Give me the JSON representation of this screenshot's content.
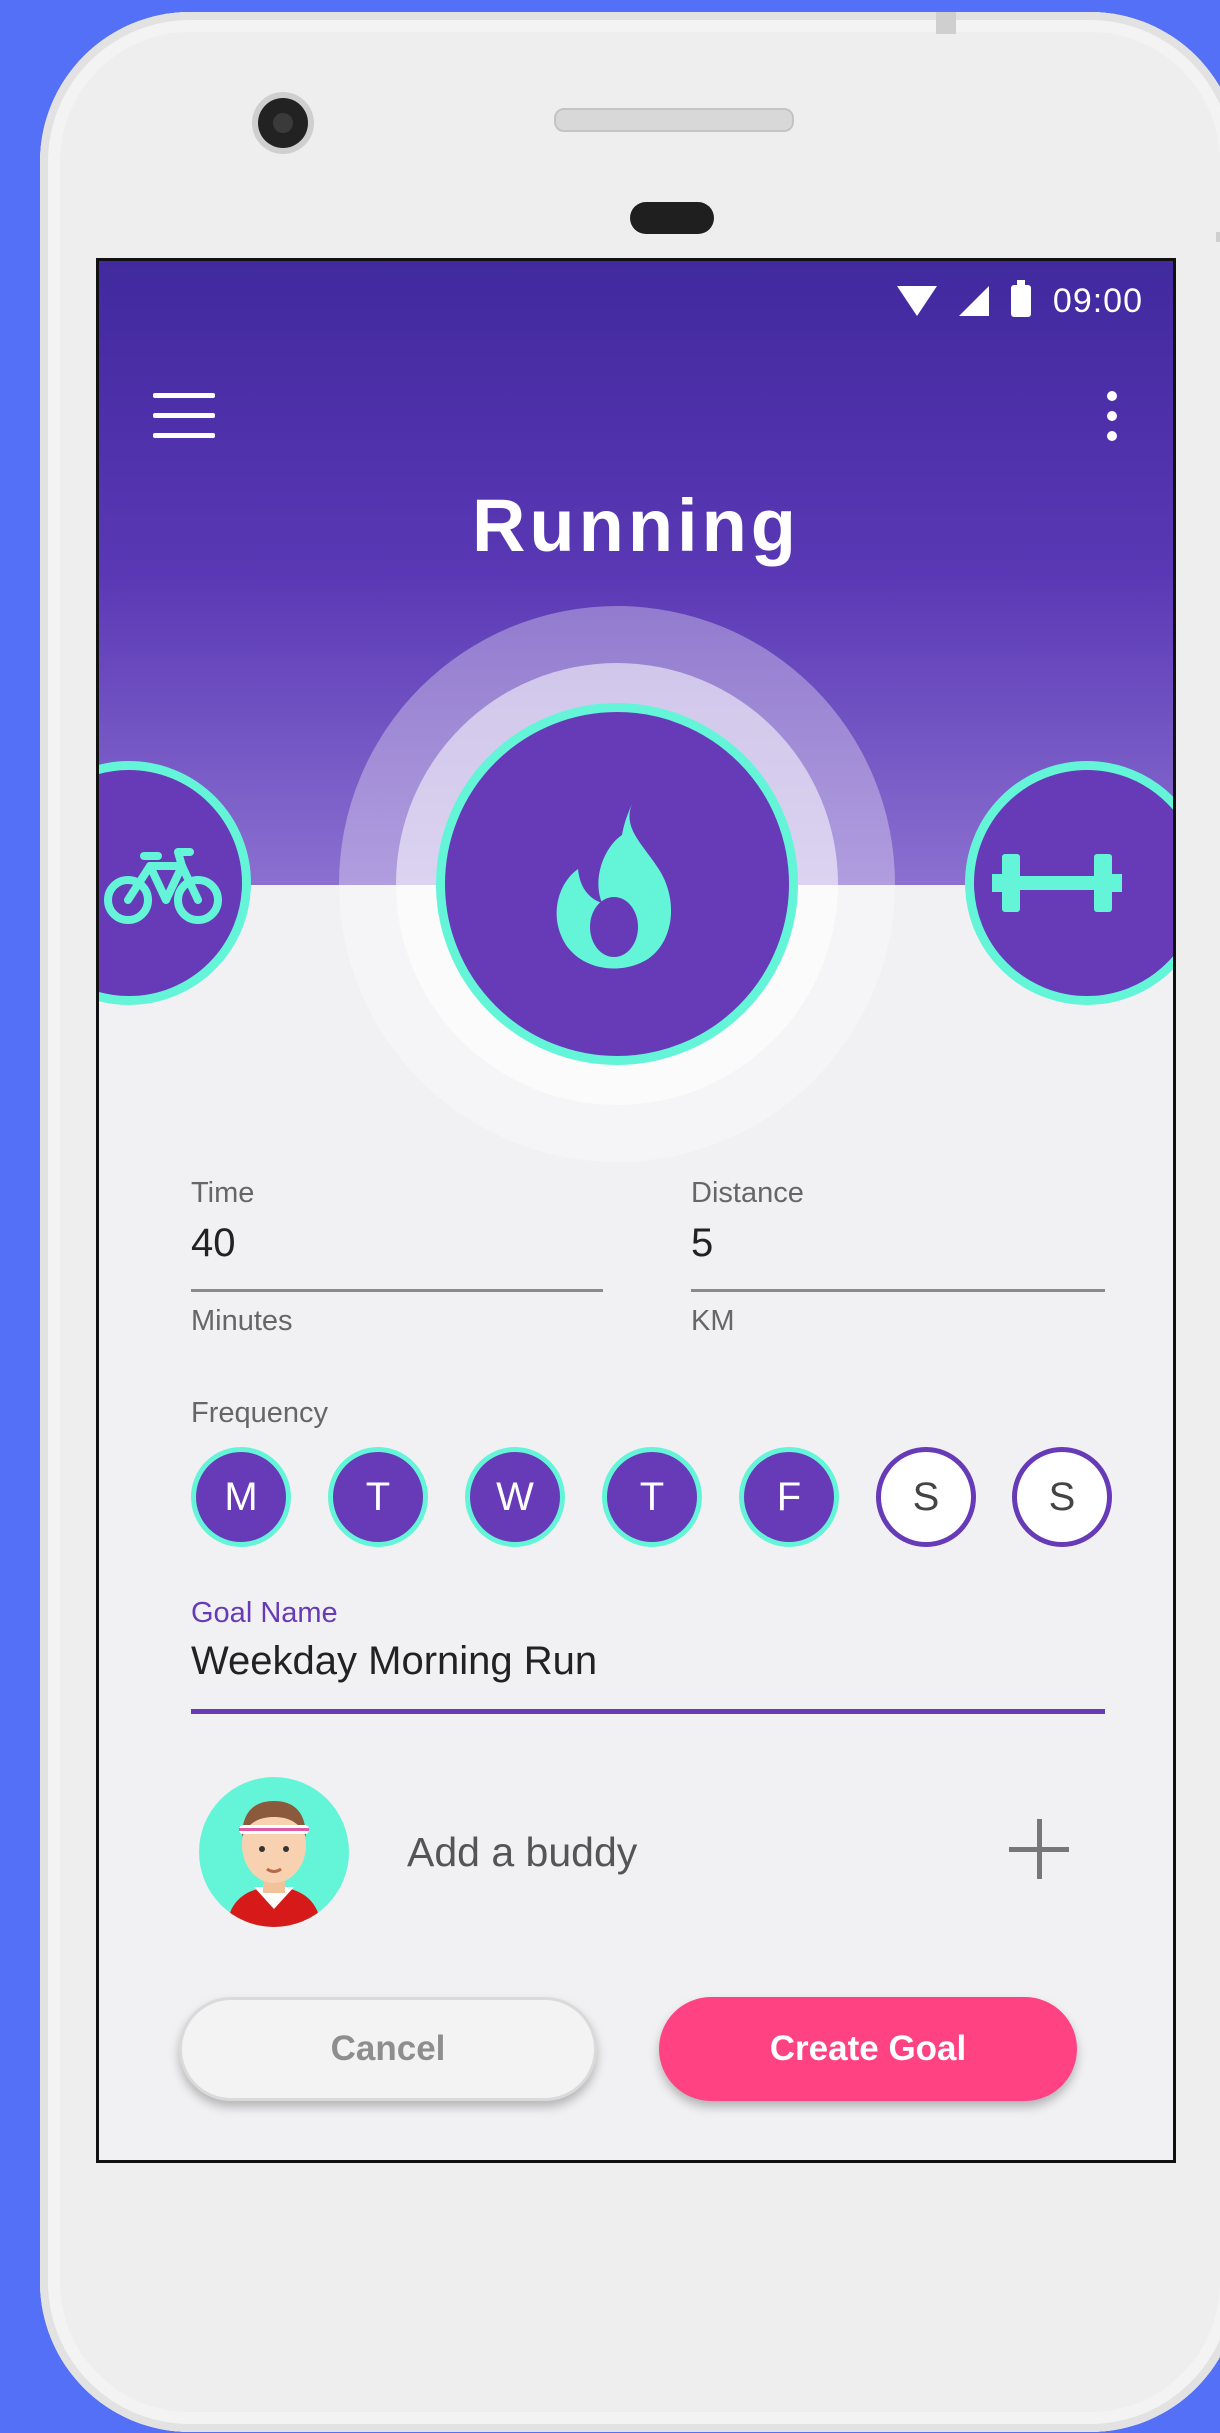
{
  "colors": {
    "background": "#5470f7",
    "header_top": "#41299e",
    "primary_purple": "#673ab7",
    "accent_mint": "#64f5d9",
    "create_button": "#ff4281"
  },
  "status_bar": {
    "time": "09:00",
    "icons": [
      "wifi-icon",
      "signal-icon",
      "battery-icon"
    ]
  },
  "toolbar": {
    "menu_icon": "hamburger-menu-icon",
    "more_icon": "more-vert-icon"
  },
  "header": {
    "title": "Running"
  },
  "activities": [
    {
      "icon": "bicycle-icon",
      "selected": false
    },
    {
      "icon": "flame-icon",
      "selected": true
    },
    {
      "icon": "dumbbell-icon",
      "selected": false
    }
  ],
  "time_field": {
    "label": "Time",
    "value": "40",
    "helper": "Minutes"
  },
  "distance_field": {
    "label": "Distance",
    "value": "5",
    "helper": "KM"
  },
  "frequency": {
    "label": "Frequency",
    "days": [
      {
        "letter": "M",
        "selected": true
      },
      {
        "letter": "T",
        "selected": true
      },
      {
        "letter": "W",
        "selected": true
      },
      {
        "letter": "T",
        "selected": true
      },
      {
        "letter": "F",
        "selected": true
      },
      {
        "letter": "S",
        "selected": false
      },
      {
        "letter": "S",
        "selected": false
      }
    ]
  },
  "goal_name": {
    "label": "Goal Name",
    "value": "Weekday Morning Run"
  },
  "buddy": {
    "label": "Add a buddy",
    "avatar_icon": "avatar-icon",
    "add_icon": "plus-icon"
  },
  "actions": {
    "cancel_label": "Cancel",
    "create_label": "Create Goal"
  }
}
